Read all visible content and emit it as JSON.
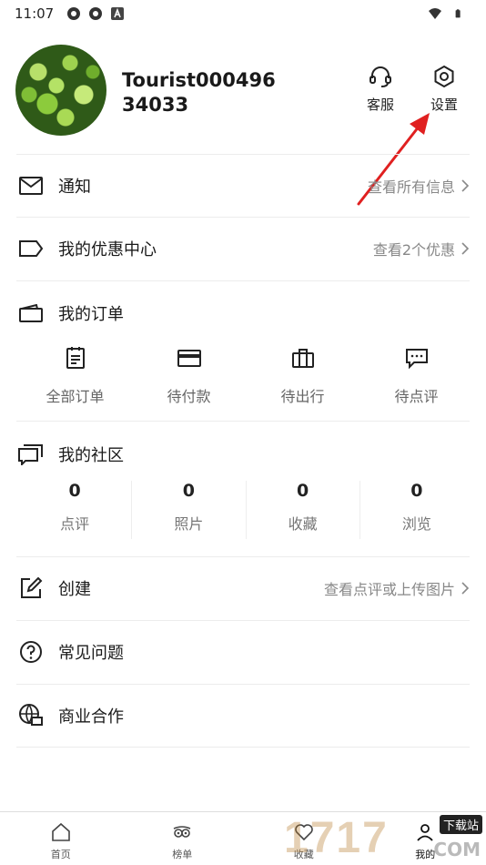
{
  "status_bar": {
    "time": "11:07"
  },
  "profile": {
    "username": "Tourist00049634033",
    "service_label": "客服",
    "settings_label": "设置"
  },
  "rows": {
    "notifications": {
      "title": "通知",
      "more": "查看所有信息"
    },
    "coupons": {
      "title": "我的优惠中心",
      "more": "查看2个优惠"
    },
    "create": {
      "title": "创建",
      "more": "查看点评或上传图片"
    },
    "faq": {
      "title": "常见问题"
    },
    "business": {
      "title": "商业合作"
    }
  },
  "orders": {
    "title": "我的订单",
    "items": [
      {
        "label": "全部订单",
        "icon": "clipboard-icon"
      },
      {
        "label": "待付款",
        "icon": "credit-card-icon"
      },
      {
        "label": "待出行",
        "icon": "suitcase-icon"
      },
      {
        "label": "待点评",
        "icon": "comment-icon"
      }
    ]
  },
  "community": {
    "title": "我的社区",
    "stats": [
      {
        "value": "0",
        "label": "点评"
      },
      {
        "value": "0",
        "label": "照片"
      },
      {
        "value": "0",
        "label": "收藏"
      },
      {
        "value": "0",
        "label": "浏览"
      }
    ]
  },
  "tabbar": {
    "items": [
      {
        "label": "首页",
        "icon": "home-icon"
      },
      {
        "label": "榜单",
        "icon": "owl-icon"
      },
      {
        "label": "收藏",
        "icon": "heart-icon"
      },
      {
        "label": "我的",
        "icon": "person-icon"
      }
    ],
    "active_index": 3
  },
  "watermark": {
    "digits": "1717",
    "tag": "下载站",
    "suffix": ".COM"
  },
  "colors": {
    "annotation_arrow": "#e02020",
    "accent_text": "#1a1a1a",
    "secondary_text": "#888888"
  }
}
